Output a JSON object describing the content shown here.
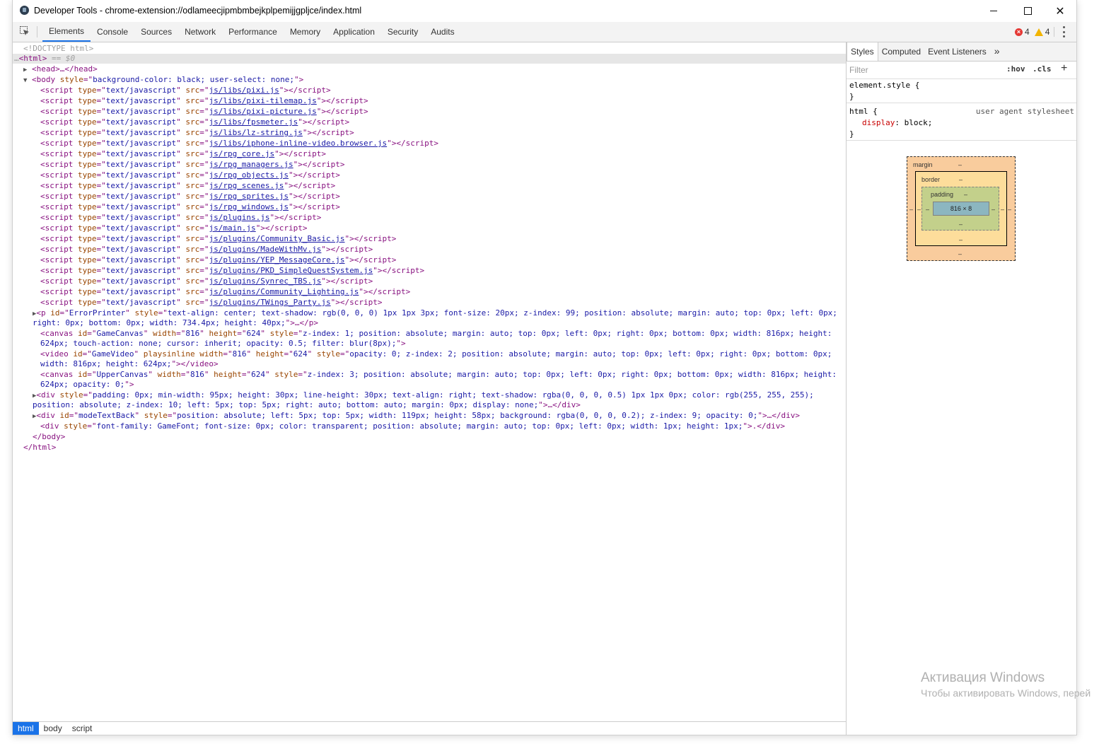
{
  "window": {
    "title": "Developer Tools - chrome-extension://odlameecjipmbmbejkplpemijjgpljce/index.html"
  },
  "toolbar": {
    "tabs": [
      "Elements",
      "Console",
      "Sources",
      "Network",
      "Performance",
      "Memory",
      "Application",
      "Security",
      "Audits"
    ],
    "active_tab": "Elements",
    "error_count": "4",
    "warning_count": "4"
  },
  "dom": {
    "doctype": "<!DOCTYPE html>",
    "html_open": "<html>",
    "selected_marker": "== $0",
    "head": "<head>…</head>",
    "body_open_tag": "<body",
    "body_style": "background-color: black; user-select: none;",
    "scripts": [
      "js/libs/pixi.js",
      "js/libs/pixi-tilemap.js",
      "js/libs/pixi-picture.js",
      "js/libs/fpsmeter.js",
      "js/libs/lz-string.js",
      "js/libs/iphone-inline-video.browser.js",
      "js/rpg_core.js",
      "js/rpg_managers.js",
      "js/rpg_objects.js",
      "js/rpg_scenes.js",
      "js/rpg_sprites.js",
      "js/rpg_windows.js",
      "js/plugins.js",
      "js/main.js",
      "js/plugins/Community_Basic.js",
      "js/plugins/MadeWithMv.js",
      "js/plugins/YEP_MessageCore.js",
      "js/plugins/PKD_SimpleQuestSystem.js",
      "js/plugins/Synrec_TBS.js",
      "js/plugins/Community_Lighting.js",
      "js/plugins/TWings_Party.js"
    ],
    "error_printer_style": "text-align: center; text-shadow: rgb(0, 0, 0) 1px 1px 3px; font-size: 20px; z-index: 99; position: absolute; margin: auto; top: 0px; left: 0px;",
    "error_printer_style_2": "right: 0px; bottom: 0px; width: 734.4px; height: 40px;",
    "game_canvas_style": "z-index: 1; position: absolute; margin: auto; top: 0px; left: 0px; right: 0px; bottom: 0px; width: 816px; height:",
    "game_canvas_style_2": "624px; touch-action: none; cursor: inherit; opacity: 0.5; filter: blur(8px);",
    "game_video_style": "opacity: 0; z-index: 2; position: absolute; margin: auto; top: 0px; left: 0px; right: 0px; bottom: 0px;",
    "game_video_style_2": "width: 816px; height: 624px;",
    "upper_canvas_style": "z-index: 3; position: absolute; margin: auto; top: 0px; left: 0px; right: 0px; bottom: 0px; width: 816px; height:",
    "upper_canvas_style_2": "624px; opacity: 0;",
    "fps_div_style": "padding: 0px; min-width: 95px; height: 30px; line-height: 30px; text-align: right; text-shadow: rgba(0, 0, 0, 0.5) 1px 1px 0px; color: rgb(255, 255, 255);",
    "fps_div_style_2": "position: absolute; z-index: 10; left: 5px; top: 5px; right: auto; bottom: auto; margin: 0px; display: none;",
    "mode_text_style": "position: absolute; left: 5px; top: 5px; width: 119px; height: 58px; background: rgba(0, 0, 0, 0.2); z-index: 9; opacity: 0;",
    "font_div_style": "font-family: GameFont; font-size: 0px; color: transparent; position: absolute; margin: auto; top: 0px; left: 0px; width: 1px; height: 1px;",
    "body_close": "</body>",
    "html_close": "</html>"
  },
  "breadcrumbs": [
    "html",
    "body",
    "script"
  ],
  "sidebar": {
    "tabs": [
      "Styles",
      "Computed",
      "Event Listeners"
    ],
    "more": "»",
    "filter_placeholder": "Filter",
    "hov": ":hov",
    "cls": ".cls",
    "element_style": "element.style {",
    "close_brace": "}",
    "html_selector": "html {",
    "ua_label": "user agent stylesheet",
    "prop_name": "display",
    "prop_value": "block;",
    "box_model": {
      "margin_label": "margin",
      "border_label": "border",
      "padding_label": "padding",
      "dash": "–",
      "content_size": "816 × 8"
    }
  },
  "watermark": {
    "line1": "Активация Windows",
    "line2": "Чтобы активировать Windows, перей"
  }
}
